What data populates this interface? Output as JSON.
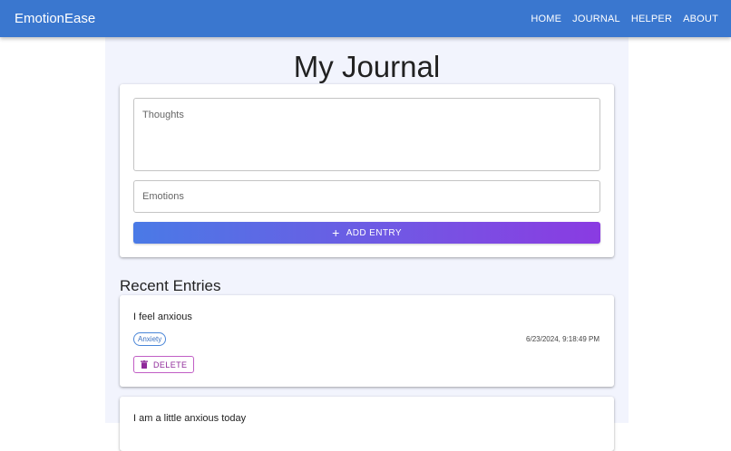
{
  "header": {
    "brand": "EmotionEase",
    "nav": [
      "HOME",
      "JOURNAL",
      "HELPER",
      "ABOUT"
    ]
  },
  "page": {
    "title": "My Journal"
  },
  "form": {
    "thoughts_placeholder": "Thoughts",
    "emotions_placeholder": "Emotions",
    "add_button_label": "ADD ENTRY",
    "add_icon": "plus-icon"
  },
  "recent": {
    "title": "Recent Entries",
    "entries": [
      {
        "text": "I feel anxious",
        "emotion": "Anxiety",
        "timestamp": "6/23/2024, 9:18:49 PM",
        "delete_label": "DELETE",
        "delete_icon": "trash-icon"
      },
      {
        "text": "I am a little anxious today"
      }
    ]
  },
  "colors": {
    "appbar": "#3a77cf",
    "background": "#f2f4fd",
    "button_gradient_start": "#4a7ae6",
    "button_gradient_end": "#8a3be2",
    "chip_border": "#4a86d8",
    "delete_color": "#8f2a9a"
  }
}
